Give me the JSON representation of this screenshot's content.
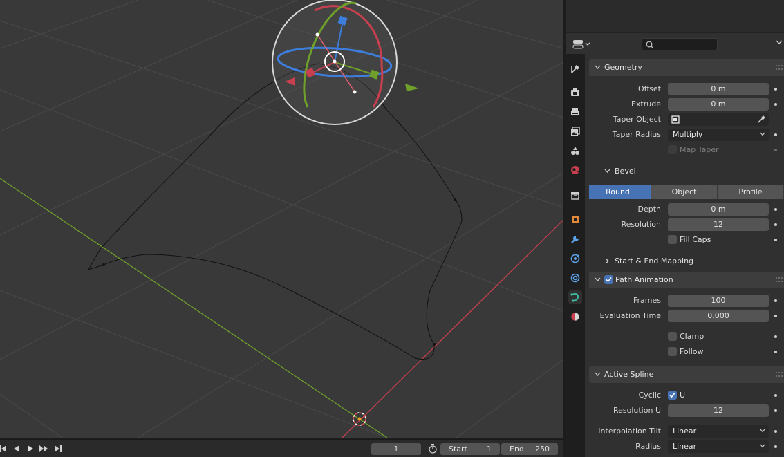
{
  "timeline": {
    "current_frame": "1",
    "start_label": "Start",
    "start_value": "1",
    "end_label": "End",
    "end_value": "250"
  },
  "properties": {
    "geometry": {
      "title": "Geometry",
      "offset_label": "Offset",
      "offset_value": "0 m",
      "extrude_label": "Extrude",
      "extrude_value": "0 m",
      "taper_object_label": "Taper Object",
      "taper_radius_label": "Taper Radius",
      "taper_radius_value": "Multiply",
      "map_taper_label": "Map Taper"
    },
    "bevel": {
      "title": "Bevel",
      "modes": [
        "Round",
        "Object",
        "Profile"
      ],
      "active_mode": "Round",
      "depth_label": "Depth",
      "depth_value": "0 m",
      "resolution_label": "Resolution",
      "resolution_value": "12",
      "fill_caps_label": "Fill Caps",
      "start_end_mapping_label": "Start & End Mapping"
    },
    "path_animation": {
      "title": "Path Animation",
      "enabled": true,
      "frames_label": "Frames",
      "frames_value": "100",
      "evaluation_time_label": "Evaluation Time",
      "evaluation_time_value": "0.000",
      "clamp_label": "Clamp",
      "follow_label": "Follow"
    },
    "active_spline": {
      "title": "Active Spline",
      "cyclic_label": "Cyclic",
      "cyclic_u_label": "U",
      "cyclic_u": true,
      "resolution_u_label": "Resolution U",
      "resolution_u_value": "12",
      "interpolation_tilt_label": "Interpolation Tilt",
      "interpolation_tilt_value": "Linear",
      "radius_label": "Radius",
      "radius_value": "Linear"
    }
  },
  "colors": {
    "accent": "#4772b3",
    "x_axis": "#c8404f",
    "y_axis": "#6ea02a",
    "z_axis": "#3d7ddb"
  }
}
